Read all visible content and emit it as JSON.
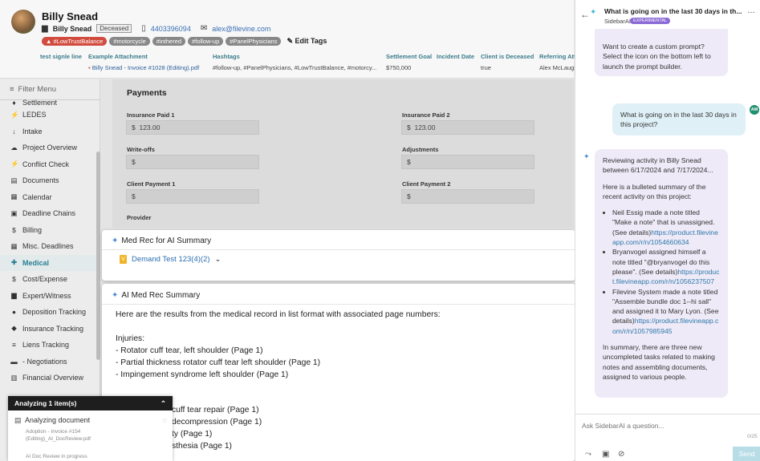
{
  "header": {
    "client_name": "Billy Snead",
    "sub_name": "Billy Snead",
    "deceased_label": "Deceased",
    "phone": "4403396094",
    "email": "alex@filevine.com",
    "tags": [
      "#LowTrustBalance",
      "#motorcycle",
      "#inthered",
      "#follow-up",
      "#PanelPhysicians"
    ],
    "edit_tags_label": "Edit Tags",
    "fields": [
      {
        "label": "test signle line",
        "value": ""
      },
      {
        "label": "Example Attachment",
        "value": "Billy Snead - Invoice #1028 (Editing).pdf"
      },
      {
        "label": "Hashtags",
        "value": "#follow-up, #PanelPhysicians, #LowTrustBalance, #motorcy..."
      },
      {
        "label": "Settlement Goal",
        "value": "$750,000"
      },
      {
        "label": "Incident Date",
        "value": ""
      },
      {
        "label": "Client is Deceased",
        "value": "true"
      },
      {
        "label": "Referring Atto",
        "value": "Alex McLaugh"
      }
    ]
  },
  "sidebar": {
    "filter_label": "Filter Menu",
    "items": [
      {
        "label": "Settlement",
        "icon": "gavel-icon",
        "glyph": "♦"
      },
      {
        "label": "LEDES",
        "icon": "bolt-icon",
        "glyph": "⚡"
      },
      {
        "label": "Intake",
        "icon": "arrow-down-icon",
        "glyph": "↓"
      },
      {
        "label": "Project Overview",
        "icon": "cloud-icon",
        "glyph": "☁"
      },
      {
        "label": "Conflict Check",
        "icon": "bolt-icon",
        "glyph": "⚡"
      },
      {
        "label": "Documents",
        "icon": "document-icon",
        "glyph": "▤"
      },
      {
        "label": "Calendar",
        "icon": "calendar-icon",
        "glyph": "▦"
      },
      {
        "label": "Deadline Chains",
        "icon": "calendar-icon",
        "glyph": "▣"
      },
      {
        "label": "Billing",
        "icon": "dollar-icon",
        "glyph": "$"
      },
      {
        "label": "Misc. Deadlines",
        "icon": "calendar-icon",
        "glyph": "▦"
      },
      {
        "label": "Medical",
        "icon": "medical-icon",
        "glyph": "✚"
      },
      {
        "label": "Cost/Expense",
        "icon": "dollar-icon",
        "glyph": "$"
      },
      {
        "label": "Expert/Witness",
        "icon": "briefcase-icon",
        "glyph": "▆"
      },
      {
        "label": "Deposition Tracking",
        "icon": "info-icon",
        "glyph": "●"
      },
      {
        "label": "Insurance Tracking",
        "icon": "shield-icon",
        "glyph": "◆"
      },
      {
        "label": "Liens Tracking",
        "icon": "liens-icon",
        "glyph": "≡"
      },
      {
        "label": "- Negotiations",
        "icon": "chat-icon",
        "glyph": "▬"
      },
      {
        "label": "Financial Overview",
        "icon": "chart-icon",
        "glyph": "▥"
      }
    ],
    "active": "Medical"
  },
  "payments": {
    "title": "Payments",
    "fields": [
      {
        "label": "Insurance Paid 1",
        "value": "123.00"
      },
      {
        "label": "Insurance Paid 2",
        "value": "123.00"
      },
      {
        "label": "Write-offs",
        "value": ""
      },
      {
        "label": "Adjustments",
        "value": ""
      },
      {
        "label": "Client Payment 1",
        "value": ""
      },
      {
        "label": "Client Payment 2",
        "value": ""
      }
    ],
    "currency": "$",
    "provider_label": "Provider"
  },
  "medrec": {
    "title": "Med Rec for AI Summary",
    "selected_doc": "Demand Test 123(4)(2)"
  },
  "summary": {
    "title": "AI Med Rec Summary",
    "intro": "Here are the results from the medical record in list format with associated page numbers:",
    "injuries_heading": "Injuries:",
    "injuries": [
      "- Rotator cuff tear, left shoulder (Page 1)",
      "- Partial thickness rotator cuff tear left shoulder (Page 1)",
      "- Impingement syndrome left shoulder (Page 1)"
    ],
    "procedures_partial": [
      "cuff tear repair (Page 1)",
      "decompression (Page 1)",
      "ty (Page 1)",
      "sthesia (Page 1)"
    ]
  },
  "analyzing": {
    "header": "Analyzing 1 item(s)",
    "row_label": "Analyzing document",
    "file_name": "Adoption - Invoice #154 (Editing)_AI_DocReview.pdf",
    "status": "AI Doc Review in progress"
  },
  "chat": {
    "title": "What is going on in the last 30 days in th...",
    "app_name": "SidebarAI",
    "badge": "EXPERIMENTAL",
    "tip": "Want to create a custom prompt? Select the icon on the bottom left to launch the prompt builder.",
    "user_initials": "AM",
    "user_message": "What is going on in the last 30 days in this project?",
    "reply_intro": "Reviewing activity in Billy Snead between 6/17/2024 and 7/17/2024...",
    "reply_lead": "Here is a bulleted summary of the recent activity on this project:",
    "bullets": [
      {
        "text": "Neil Essig made a note titled \"Make a note\" that is unassigned. (See details)",
        "link": "https://product.filevineapp.com/r/n/1054660634"
      },
      {
        "text": "Bryanvogel assigned himself a note titled \"@bryanvogel do this please\". (See details)",
        "link": "https://product.filevineapp.com/r/n/1056237507"
      },
      {
        "text": "Filevine System made a note titled \"Assemble bundle doc 1--hi sall\" and assigned it to Mary Lyon. (See details)",
        "link": "https://product.filevineapp.com/r/n/1057985945"
      }
    ],
    "reply_outro": "In summary, there are three new uncompleted tasks related to making notes and assembling documents, assigned to various people.",
    "input_placeholder": "Ask SidebarAI a question...",
    "char_count": "0/25",
    "send_label": "Send"
  }
}
